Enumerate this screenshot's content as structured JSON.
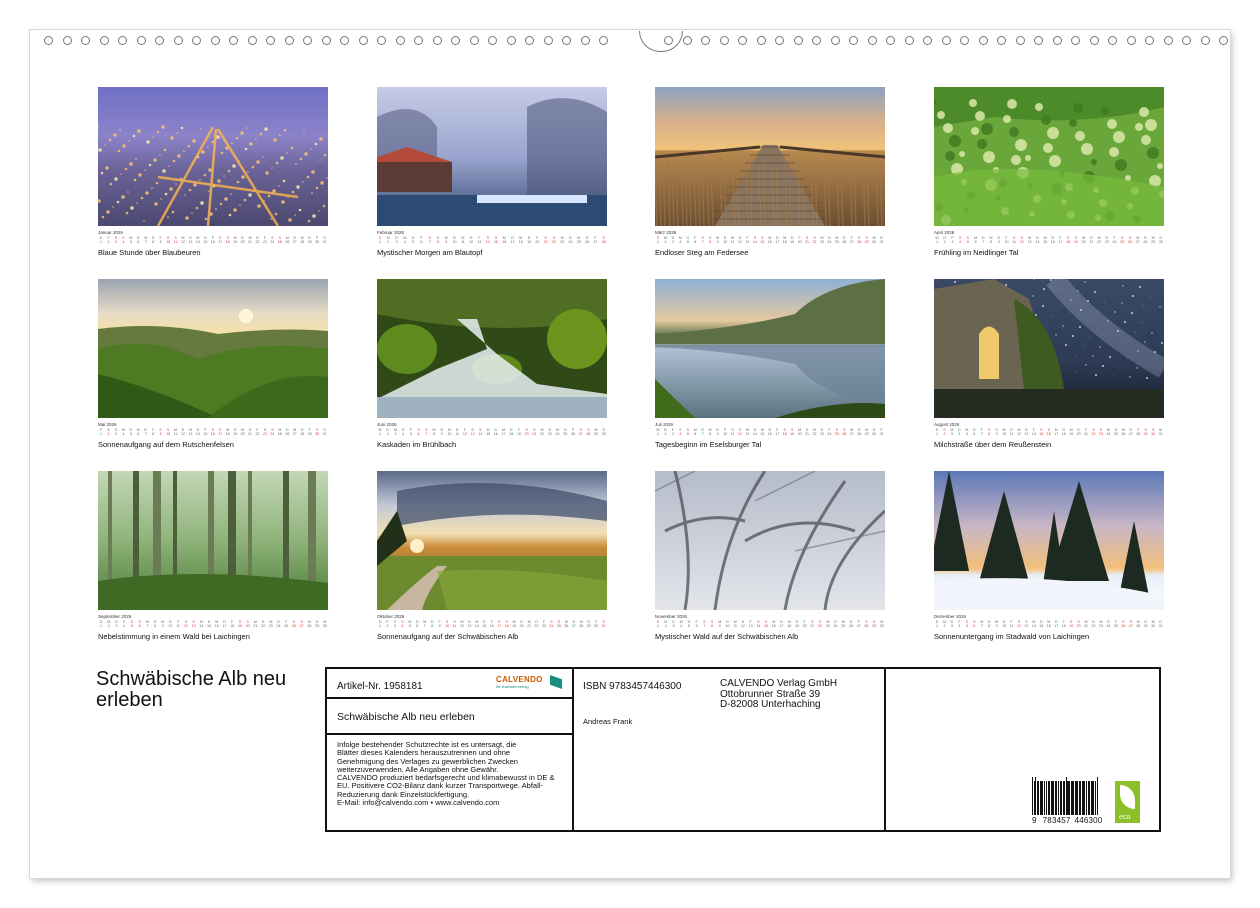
{
  "calendar": {
    "title": "Schwäbische Alb neu erleben",
    "months": [
      {
        "name": "Januar 2026",
        "caption": "Blaue Stunde über Blaubeuren",
        "scene": "night-town",
        "day_count": 31,
        "first_weekday": 3
      },
      {
        "name": "Februar 2026",
        "caption": "Mystischer Morgen am Blautopf",
        "scene": "misty-pond",
        "day_count": 28,
        "first_weekday": 6
      },
      {
        "name": "März 2026",
        "caption": "Endloser Steg am Federsee",
        "scene": "boardwalk",
        "day_count": 31,
        "first_weekday": 6
      },
      {
        "name": "April 2026",
        "caption": "Frühling im Neidlinger Tal",
        "scene": "green-valley",
        "day_count": 30,
        "first_weekday": 2
      },
      {
        "name": "Mai 2026",
        "caption": "Sonnenaufgang auf dem Rutschenfelsen",
        "scene": "sunrise-hills",
        "day_count": 31,
        "first_weekday": 4
      },
      {
        "name": "Juni 2026",
        "caption": "Kaskaden im Brühlbach",
        "scene": "cascade",
        "day_count": 30,
        "first_weekday": 0
      },
      {
        "name": "Juli 2026",
        "caption": "Tagesbeginn im Eselsburger Tal",
        "scene": "lake-reflection",
        "day_count": 31,
        "first_weekday": 2
      },
      {
        "name": "August 2026",
        "caption": "Milchstraße über dem Reußenstein",
        "scene": "milky-way",
        "day_count": 31,
        "first_weekday": 5
      },
      {
        "name": "September 2026",
        "caption": "Nebelstimmung in einem Wald bei Laichingen",
        "scene": "foggy-forest",
        "day_count": 30,
        "first_weekday": 1
      },
      {
        "name": "Oktober 2026",
        "caption": "Sonnenaufgang auf der Schwäbischen Alb",
        "scene": "sunrise-road",
        "day_count": 31,
        "first_weekday": 3
      },
      {
        "name": "November 2026",
        "caption": "Mystischer Wald auf der Schwäbischen Alb",
        "scene": "misty-trees",
        "day_count": 30,
        "first_weekday": 6
      },
      {
        "name": "Dezember 2026",
        "caption": "Sonnenuntergang im Stadwald von Laichingen",
        "scene": "winter-sunset",
        "day_count": 31,
        "first_weekday": 1
      }
    ]
  },
  "info": {
    "article_no": "Artikel-Nr. 1958181",
    "logo_text": "CALVENDO",
    "logo_sub": "Ihr Kalenderverlag",
    "subtitle": "Schwäbische Alb neu erleben",
    "legal": [
      "Infolge bestehender Schutzrechte ist es untersagt, die",
      "Blätter dieses Kalenders herauszutrennen und ohne",
      "Genehmigung des Verlages zu gewerblichen Zwecken",
      "weiterzuverwenden. Alle Angaben ohne Gewähr.",
      "CALVENDO produziert bedarfsgerecht und klimabewusst in DE &",
      "EU. Positivere CO2-Bilanz dank kurzer Transportwege. Abfall-",
      "Reduzierung dank Einzelstückfertigung.",
      "E-Mail: info@calvendo.com • www.calvendo.com"
    ],
    "isbn": "ISBN 9783457446300",
    "publisher": [
      "CALVENDO Verlag GmbH",
      "Ottobrunner Straße 39",
      "D-82008 Unterhaching"
    ],
    "author": "Andreas Frank",
    "barcode_digits": [
      "9",
      "783457",
      "446300"
    ],
    "eco_label": "eco"
  },
  "colors": {
    "weekend_red": "#dd3333",
    "calvendo_orange": "#c85a00",
    "calvendo_teal": "#1a8f7f",
    "eco_green": "#8cbf2a"
  }
}
